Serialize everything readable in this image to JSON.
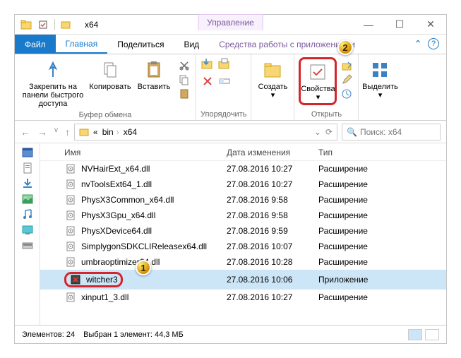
{
  "title": "x64",
  "manage_tab": "Управление",
  "tabs": {
    "file": "Файл",
    "home": "Главная",
    "share": "Поделиться",
    "view": "Вид",
    "apps": "Средства работы с приложениями"
  },
  "ribbon": {
    "pin": "Закрепить на панели быстрого доступа",
    "copy": "Копировать",
    "paste": "Вставить",
    "clipboard_group": "Буфер обмена",
    "organize_group": "Упорядочить",
    "create": "Создать",
    "properties": "Свойства",
    "open_group": "Открыть",
    "select": "Выделить"
  },
  "breadcrumb": {
    "p1": "bin",
    "p2": "x64"
  },
  "search_placeholder": "Поиск: x64",
  "columns": {
    "name": "Имя",
    "date": "Дата изменения",
    "type": "Тип"
  },
  "files": [
    {
      "name": "NVHairExt_x64.dll",
      "date": "27.08.2016 10:27",
      "type": "Расширение"
    },
    {
      "name": "nvToolsExt64_1.dll",
      "date": "27.08.2016 10:27",
      "type": "Расширение"
    },
    {
      "name": "PhysX3Common_x64.dll",
      "date": "27.08.2016 9:58",
      "type": "Расширение"
    },
    {
      "name": "PhysX3Gpu_x64.dll",
      "date": "27.08.2016 9:58",
      "type": "Расширение"
    },
    {
      "name": "PhysXDevice64.dll",
      "date": "27.08.2016 9:59",
      "type": "Расширение"
    },
    {
      "name": "SimplygonSDKCLIReleasex64.dll",
      "date": "27.08.2016 10:07",
      "type": "Расширение"
    },
    {
      "name": "umbraoptimizer64.dll",
      "date": "27.08.2016 10:28",
      "type": "Расширение"
    },
    {
      "name": "witcher3",
      "date": "27.08.2016 10:06",
      "type": "Приложение",
      "selected": true
    },
    {
      "name": "xinput1_3.dll",
      "date": "27.08.2016 10:27",
      "type": "Расширение"
    }
  ],
  "status": {
    "count": "Элементов: 24",
    "selected": "Выбран 1 элемент: 44,3 МБ"
  }
}
